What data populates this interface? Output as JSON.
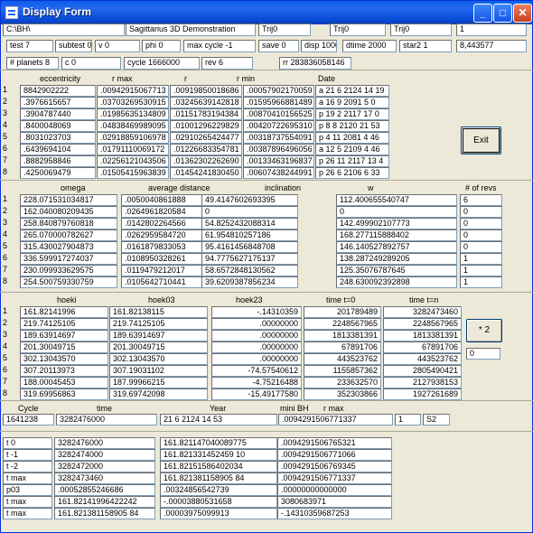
{
  "window": {
    "title": "Display Form",
    "min": "_",
    "max": "□",
    "close": "✕"
  },
  "row1": [
    "C:\\BH\\",
    "Sagittarius 3D Demonstration",
    "Trij0",
    "Trij0",
    "Trij0",
    "1"
  ],
  "row2": [
    "test  7",
    "subtest  0",
    "v  0",
    "phi 0",
    "max cycle -1",
    "save  0",
    "disp  1000",
    "dtime  2000",
    "star2  1",
    "8,443577"
  ],
  "row3": [
    "# planets  8",
    "c  0",
    "cycle  1666000",
    "rev  6",
    "rr  283836058146"
  ],
  "hdr1": [
    "eccentricity",
    "r max",
    "r",
    "r min",
    "Date"
  ],
  "idx": [
    "1",
    "2",
    "3",
    "4",
    "5",
    "6",
    "7",
    "8"
  ],
  "table1": [
    [
      "8842902222",
      ".00942915067713",
      ".00919850018686",
      ".00057902170059",
      "a 21  6 2124 14 19"
    ],
    [
      ".3976615657",
      ".03703269530915",
      ".03245639142818",
      ".01595966881489",
      "a 16  9 2091  5  0"
    ],
    [
      ".3904787440",
      ".01985635134809",
      ".01151783194384",
      ".00870410156525",
      "p 19  2 2117 17  0"
    ],
    [
      ".8400048069",
      ".04838469989095",
      ".01001296229829",
      ".00420722695310",
      "p  8  8 2120 21 53"
    ],
    [
      ".8031023703",
      ".02918859106978",
      ".02910265424477",
      ".00318737554091",
      "p  4 11 2081  4 46"
    ],
    [
      ".6439694104",
      ".01791110069172",
      ".01226683354781",
      ".00387896496056",
      "a 12  5 2109  4 46"
    ],
    [
      ".8882958846",
      ".02256121043506",
      ".01362302262690",
      ".00133463196837",
      "p 26 11 2117 13  4"
    ],
    [
      ".4250069479",
      ".01505415963839",
      ".01454241830450",
      ".00607438244991",
      "p 26  6 2106  6 33"
    ]
  ],
  "exit": "Exit",
  "hdr2": [
    "omega",
    "average distance",
    "inclination",
    "w",
    "# of revs"
  ],
  "table2": [
    [
      "228.071531034817",
      ".0050040861888",
      "49.4147602693395",
      "112.400655540747",
      "6"
    ],
    [
      "162.040080209435",
      ".0264961820584",
      "0",
      "0",
      "0"
    ],
    [
      "258.840879760818",
      ".0142802264566",
      "54.8252432088314",
      "142.499902107773",
      "0"
    ],
    [
      "265.070000782627",
      ".0262959584720",
      "61.954810257186",
      "168.277115888402",
      "0"
    ],
    [
      "315.430027904873",
      ".0161879833053",
      "95.4161456848708",
      "146.140527892757",
      "0"
    ],
    [
      "336.599917274037",
      ".0108950328261",
      "94.7775627175137",
      "138.287249289205",
      "1"
    ],
    [
      "230.099933629575",
      ".0119479212017",
      "58.6572848130562",
      "125.35076787645",
      "1"
    ],
    [
      "254.500759330759",
      ".0105642710441",
      "39.6209387856234",
      "248.630092392898",
      "1"
    ]
  ],
  "hdr3": [
    "hoeki",
    "hoek03",
    "hoek23",
    "time t=0",
    "time t=n"
  ],
  "table3": [
    [
      "161.82141996",
      "161.82138115",
      "-.14310359",
      "201789489",
      "3282473460"
    ],
    [
      "219.74125105",
      "219.74125105",
      ".00000000",
      "2248567965",
      "2248567965"
    ],
    [
      "189.63914697",
      "189.63914697",
      ".00000000",
      "1813381391",
      "1813381391"
    ],
    [
      "201.30049715",
      "201.30049715",
      ".00000000",
      "67891706",
      "67891706"
    ],
    [
      "302.13043570",
      "302.13043570",
      ".00000000",
      "443523762",
      "443523762"
    ],
    [
      "307.20113973",
      "307.19031102",
      "-74.57540612",
      "1155857362",
      "2805490421"
    ],
    [
      "188.00045453",
      "187.99966215",
      "-4.75216488",
      "233632570",
      "2127938153"
    ],
    [
      "319.69956863",
      "319.69742098",
      "-15.49177580",
      "352303866",
      "1927261689"
    ]
  ],
  "x2": "* 2",
  "x2val": "0",
  "hdr4": [
    "Cycle",
    "time",
    "Year",
    "mini BH",
    "r max"
  ],
  "row4": [
    "1641238",
    "3282476000",
    "21  6 2124 14 53",
    ".0094291506771337",
    "1",
    "S2"
  ],
  "table5": [
    [
      "t  0",
      "3282476000",
      "161.821147040089775",
      ".0094291506765321"
    ],
    [
      "t -1",
      "3282474000",
      "161.821331452459 10",
      ".0094291506771066"
    ],
    [
      "t -2",
      "3282472000",
      "161.82151586402034",
      ".0094291506769345"
    ],
    [
      "t max",
      "3282473460",
      "161.821381158905 84",
      ".0094291506771337"
    ],
    [
      "p03",
      ".00052855246686",
      ".00324856542739",
      ".00000000000000"
    ],
    [
      "t max",
      "161.82141996422242",
      "-.00003880531658",
      "3080683971"
    ],
    [
      "t max",
      "161.821381158905 84",
      ".00003975099913",
      "-.14310359687253"
    ]
  ]
}
